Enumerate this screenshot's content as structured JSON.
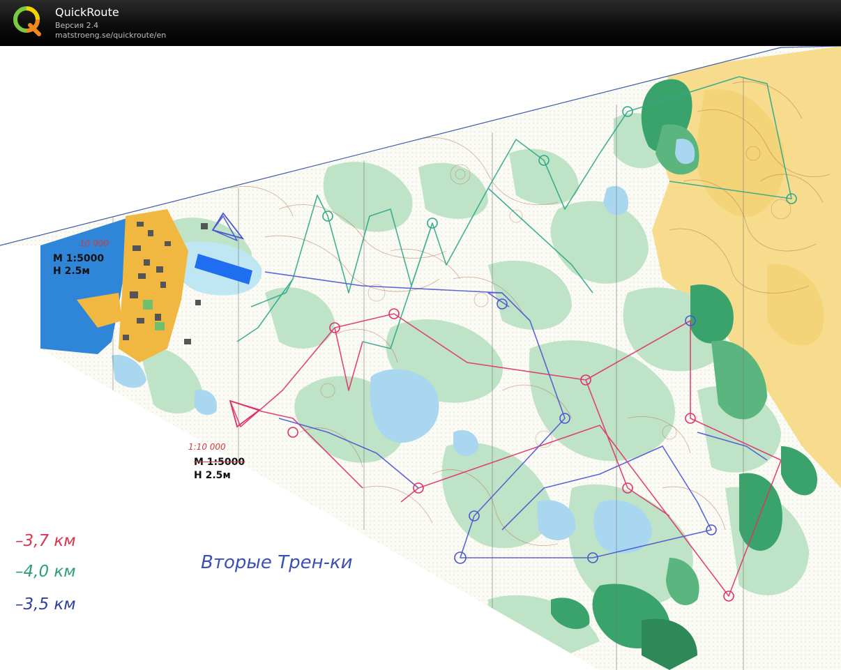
{
  "app": {
    "title": "QuickRoute",
    "version": "Версия 2.4",
    "url": "matstroeng.se/quickroute/en"
  },
  "map": {
    "legend_top": {
      "scale_handwritten": "10 000",
      "scale": "M 1:5000",
      "contour": "H 2.5м"
    },
    "legend_bottom": {
      "scale_handwritten": "1:10 000",
      "scale": "M 1:5000",
      "contour": "H 2.5м"
    },
    "distances": [
      {
        "text": "–3,7 км",
        "color": "#d9354f"
      },
      {
        "text": "–4,0 км",
        "color": "#2e9e7a"
      },
      {
        "text": "–3,5 км",
        "color": "#2f3f9e"
      }
    ],
    "handwritten_title": "Вторые Трен-ки",
    "colors": {
      "sea": "#2f86d9",
      "forest_light": "#bfe3c6",
      "forest_dark": "#3aa36b",
      "open_land": "#f6dc8c",
      "course_red": "#e0306a",
      "course_green": "#2ea88a",
      "course_blue": "#4a55d0"
    }
  }
}
